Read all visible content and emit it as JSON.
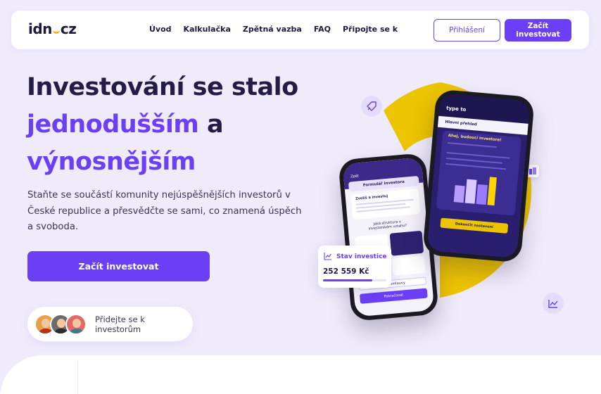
{
  "header": {
    "logo_left": "idn",
    "logo_right": "cz",
    "nav": [
      "Úvod",
      "Kalkulačka",
      "Zpětná vazba",
      "FAQ",
      "Připojte se k"
    ],
    "login_label": "Přihlášení",
    "start_label": "Začít investovat"
  },
  "hero": {
    "title_line1": "Investování se stalo",
    "title_accent1": "jednodušším",
    "title_and": " a",
    "title_accent2": "výnosnějším",
    "lead": "Staňte se součástí komunity nejúspěšnějších investorů v České republice a přesvědčte se sami, co znamená úspěch a svoboda.",
    "cta_label": "Začít investovat",
    "join_label": "Přidejte se k investorům"
  },
  "phone_back": {
    "back_label": "Zpět",
    "form_title": "Formulář investora",
    "card_title": "Zvolíš a investuj",
    "question": "Jaká struktura v investorském vztahu?",
    "option": "Podle smlouvy",
    "btn_label": "Pokračovat"
  },
  "phone_front": {
    "brand": "type to",
    "section": "Hlavní přehled",
    "greeting": "Ahoj, budoucí investore!",
    "cta": "Dokončit nastavení"
  },
  "stav": {
    "title": "Stav investice",
    "value": "252 559 Kč",
    "progress": 0.78
  },
  "colors": {
    "accent": "#6b3ff5",
    "yellow": "#ecc400",
    "dark": "#231d45"
  }
}
